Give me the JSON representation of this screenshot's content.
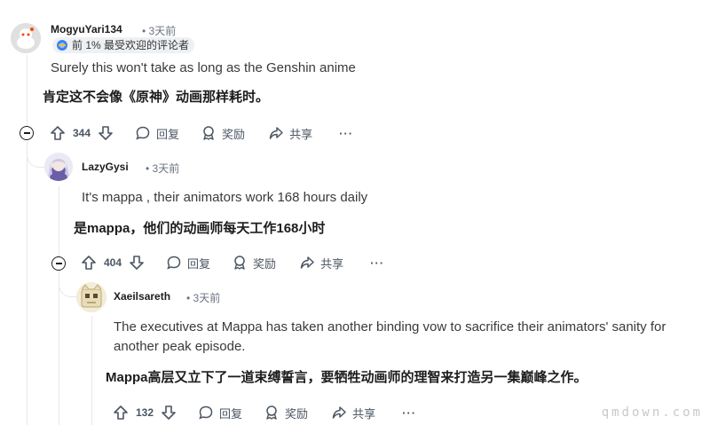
{
  "comments": [
    {
      "username": "MogyuYari134",
      "time": "• 3天前",
      "flair": "前 1% 最受欢迎的评论者",
      "text_en": "Surely this won't take as long as the Genshin anime",
      "text_cn": "肯定这不会像《原神》动画那样耗时。",
      "votes": "344",
      "reply_label": "回复",
      "award_label": "奖励",
      "share_label": "共享",
      "more_label": "···"
    },
    {
      "username": "LazyGysi",
      "time": "• 3天前",
      "text_en": "It's mappa , their animators work 168 hours daily",
      "text_cn": "是mappa，他们的动画师每天工作168小时",
      "votes": "404",
      "reply_label": "回复",
      "award_label": "奖励",
      "share_label": "共享",
      "more_label": "···"
    },
    {
      "username": "Xaeilsareth",
      "time": "• 3天前",
      "text_en_line1": "The executives at Mappa has taken another binding vow to sacrifice their animators' sanity for",
      "text_en_line2": "another peak episode.",
      "text_cn": "Mappa高层又立下了一道束缚誓言，要牺牲动画师的理智来打造另一集巅峰之作。",
      "votes": "132",
      "reply_label": "回复",
      "award_label": "奖励",
      "share_label": "共享",
      "more_label": "···"
    }
  ],
  "watermark": "qmdown.com",
  "colors": {
    "accent": "#ff4500",
    "muted": "#6b7280",
    "line": "#e5e7eb"
  }
}
